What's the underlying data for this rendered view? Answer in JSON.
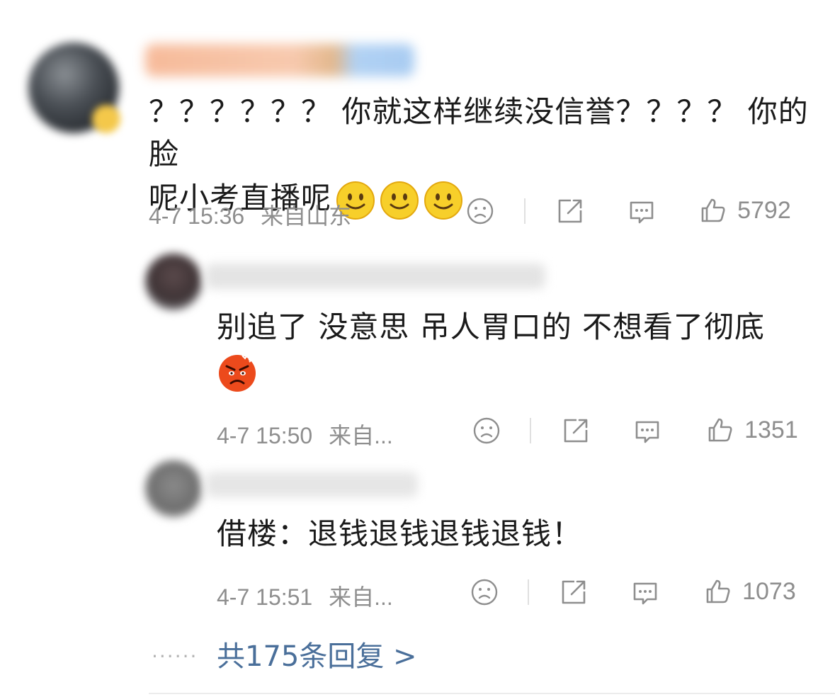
{
  "main_comment": {
    "text_line1": "？？？？？？ 你就这样继续没信誉？？？？ 你的脸",
    "text_line2": "呢小考直播呢",
    "emojis": [
      "smile",
      "smile",
      "smile"
    ],
    "time": "4-7 15:36",
    "location": "来自山东",
    "likes": "5792"
  },
  "replies": [
    {
      "text_line1": "别追了 没意思 吊人胃口的 不想看了彻底",
      "emoji": "angry",
      "time": "4-7 15:50",
      "location": "来自...",
      "likes": "1351"
    },
    {
      "text_line1": "借楼：退钱退钱退钱退钱！",
      "time": "4-7 15:51",
      "location": "来自...",
      "likes": "1073"
    }
  ],
  "footer": {
    "dots": "......",
    "more_replies": "共175条回复 >"
  },
  "icons": {
    "dislike": "sad-face-icon",
    "share": "share-icon",
    "comment": "comment-icon",
    "like": "thumbs-up-icon"
  },
  "colors": {
    "text": "#1a1a1a",
    "meta": "#8e8e8e",
    "link": "#4a6f9a",
    "emoji_smile": "#f5c518",
    "emoji_angry": "#e8451e"
  }
}
